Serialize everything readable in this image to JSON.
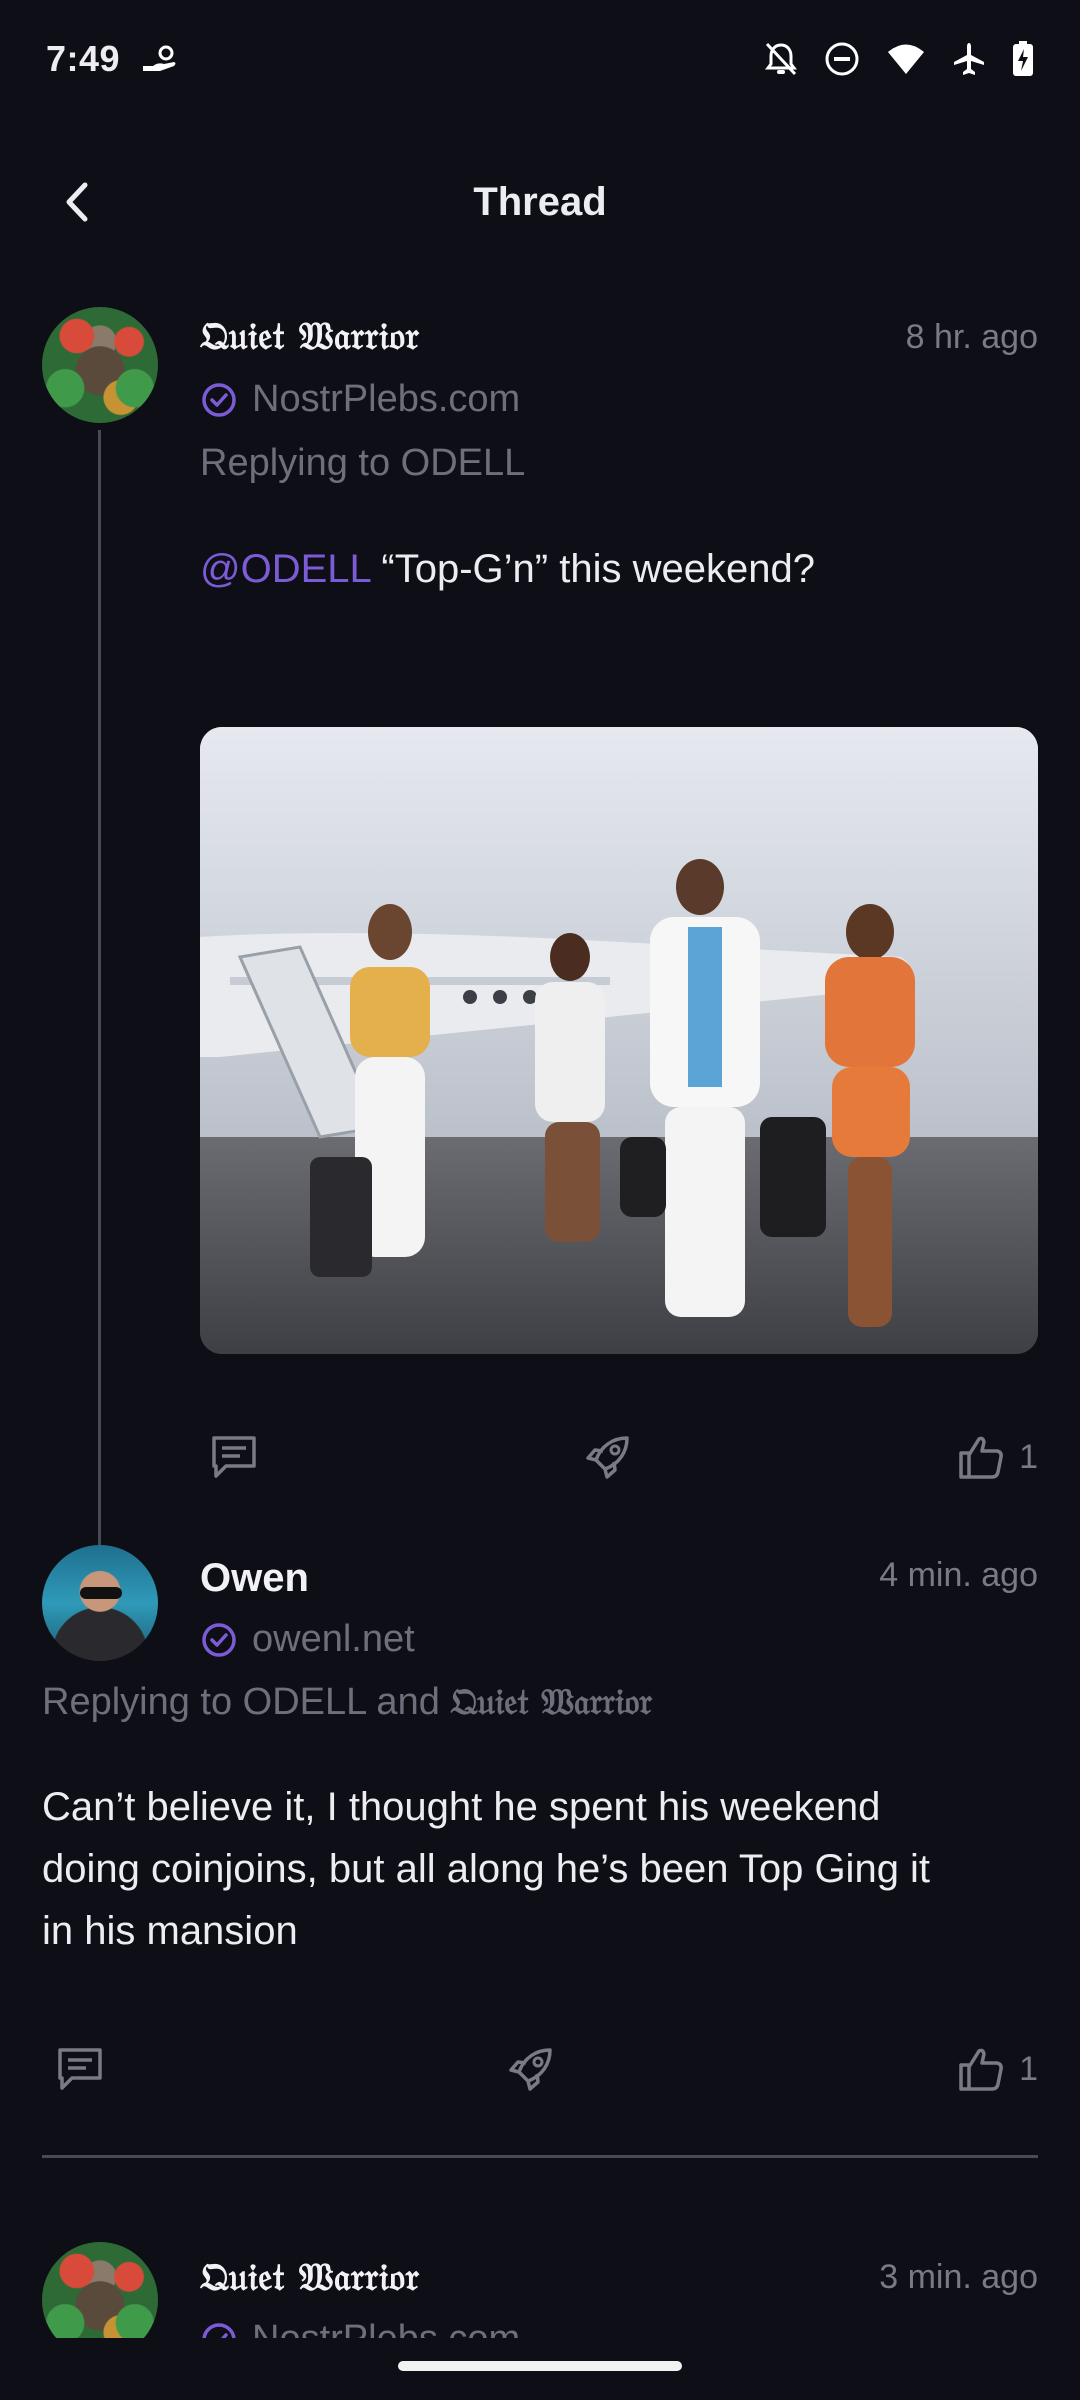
{
  "status_bar": {
    "time": "7:49",
    "left_icons": [
      "hand-coin-icon"
    ],
    "right_icons": [
      "notifications-off-icon",
      "do-not-disturb-icon",
      "wifi-icon",
      "airplane-icon",
      "battery-charging-icon"
    ]
  },
  "header": {
    "title": "Thread",
    "back_icon": "chevron-left-icon"
  },
  "posts": [
    {
      "author": "𝔔𝔲𝔦𝔢𝔱 𝔚𝔞𝔯𝔯𝔦𝔬𝔯",
      "time": "8 hr. ago",
      "nip05": "NostrPlebs.com",
      "replying_to": "Replying to ODELL",
      "mention": "@ODELL",
      "text": " “Top-G’n” this weekend?",
      "has_image": true,
      "likes": "1"
    },
    {
      "author": "Owen",
      "time": "4 min. ago",
      "nip05": "owenl.net",
      "replying_prefix": "Replying to ODELL and ",
      "replying_name": "𝔔𝔲𝔦𝔢𝔱 𝔚𝔞𝔯𝔯𝔦𝔬𝔯",
      "text_lines": [
        "Can’t believe it, I thought he spent his weekend",
        "doing coinjoins, but all along he’s been Top Ging it",
        "in his mansion"
      ],
      "likes": "1"
    },
    {
      "author": "𝔔𝔲𝔦𝔢𝔱 𝔚𝔞𝔯𝔯𝔦𝔬𝔯",
      "time": "3 min. ago",
      "nip05": "NostrPlebs.com"
    }
  ],
  "colors": {
    "background": "#0e0e16",
    "accent": "#7c5cd6",
    "muted": "#6f6f7c",
    "thread_line": "#4a4a55"
  }
}
